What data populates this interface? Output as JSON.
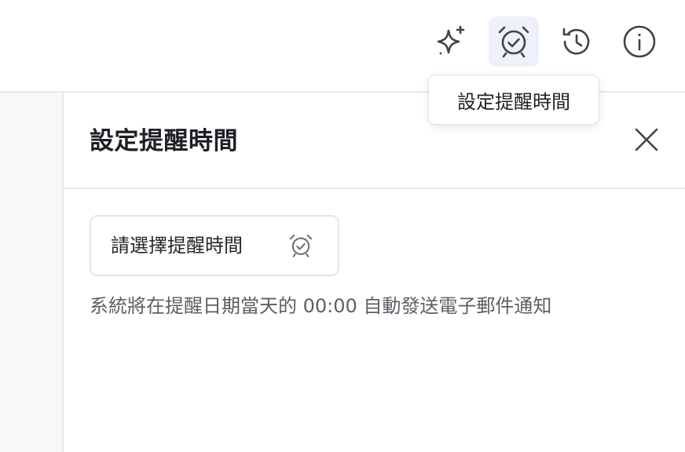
{
  "toolbar": {
    "buttons": [
      {
        "name": "ai-assistant",
        "icon": "sparkles-icon"
      },
      {
        "name": "set-reminder",
        "icon": "alarm-clock-icon",
        "active": true
      },
      {
        "name": "history",
        "icon": "history-icon"
      },
      {
        "name": "info",
        "icon": "info-icon"
      }
    ],
    "tooltip": "設定提醒時間"
  },
  "panel": {
    "title": "設定提醒時間",
    "close_icon": "close-icon",
    "reminder_button_label": "請選擇提醒時間",
    "reminder_button_icon": "alarm-clock-icon",
    "note": "系統將在提醒日期當天的 00:00 自動發送電子郵件通知"
  },
  "colors": {
    "active_bg": "#eef0fb",
    "icon": "#3f434a",
    "border": "#e6e8ec",
    "text": "#1d1f24",
    "muted_text": "#5b5f66"
  }
}
